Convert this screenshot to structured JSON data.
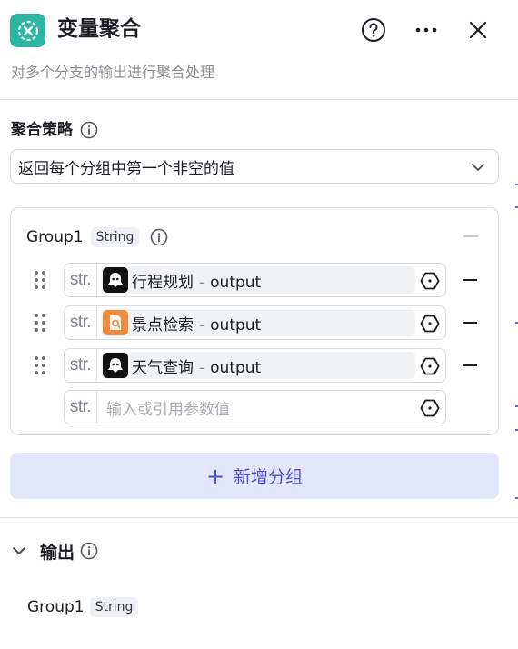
{
  "header": {
    "title": "变量聚合",
    "description": "对多个分支的输出进行聚合处理"
  },
  "strategy": {
    "label": "聚合策略",
    "selected": "返回每个分组中第一个非空的值"
  },
  "group": {
    "name": "Group1",
    "type": "String",
    "rows": [
      {
        "prefix": "str.",
        "source": "行程规划",
        "separator": "-",
        "field": "output",
        "icon": "ghost-icon",
        "icon_bg": "#111111"
      },
      {
        "prefix": "str.",
        "source": "景点检索",
        "separator": "-",
        "field": "output",
        "icon": "doc-search-icon",
        "icon_bg": "#f08a3c"
      },
      {
        "prefix": "str.",
        "source": "天气查询",
        "separator": "-",
        "field": "output",
        "icon": "ghost-icon",
        "icon_bg": "#111111"
      }
    ],
    "empty_row": {
      "prefix": "str.",
      "placeholder": "输入或引用参数值"
    }
  },
  "add_group_label": "新增分组",
  "output": {
    "title": "输出",
    "items": [
      {
        "name": "Group1",
        "type": "String"
      }
    ]
  },
  "colors": {
    "accent": "#4b4fd6",
    "node_icon": "#2bb5a3"
  }
}
